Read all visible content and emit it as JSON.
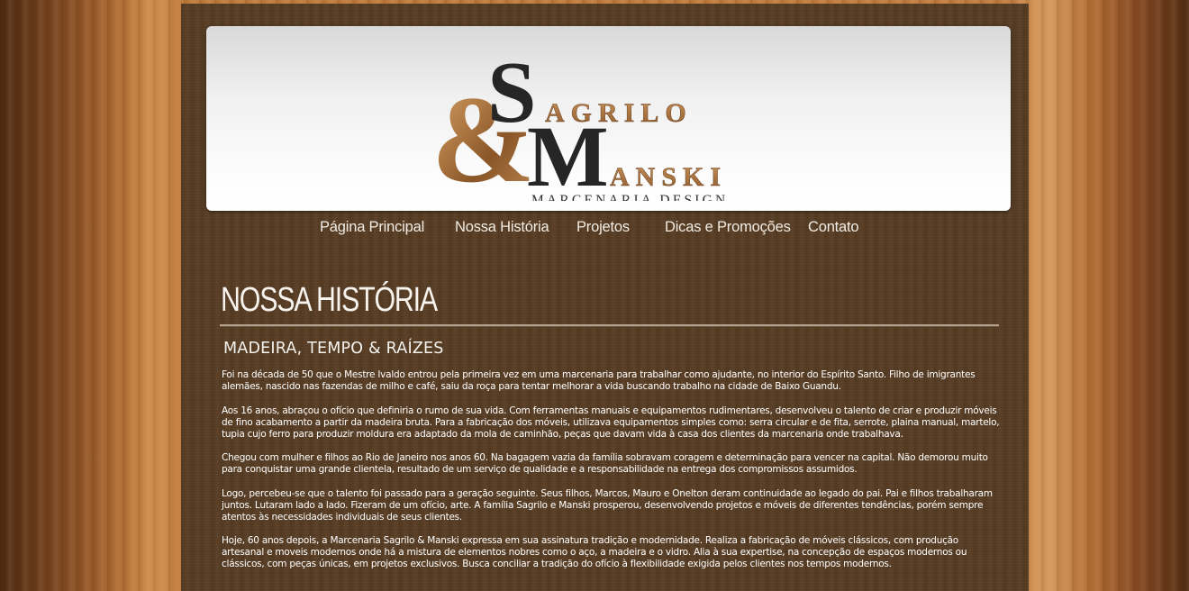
{
  "logo": {
    "big_s": "S",
    "word1": "AGRILO",
    "ampersand": "&",
    "big_m": "M",
    "word2": "ANSKI",
    "tagline": "MARCENARIA DESIGN"
  },
  "nav": {
    "items": [
      {
        "label": "Página Principal"
      },
      {
        "label": "Nossa História"
      },
      {
        "label": "Projetos"
      },
      {
        "label": "Dicas e Promoções"
      },
      {
        "label": "Contato"
      }
    ]
  },
  "page": {
    "title": "NOSSA HISTÓRIA",
    "subtitle": "MADEIRA, TEMPO & RAÍZES",
    "paragraphs": [
      "Foi na década de 50 que o Mestre Ivaldo entrou pela primeira vez em uma marcenaria para trabalhar como ajudante, no interior do Espírito Santo. Filho de imigrantes alemães, nascido nas fazendas de milho e café, saiu da roça para tentar melhorar a vida buscando trabalho na cidade de Baixo Guandu.",
      "Aos 16 anos, abraçou o ofício que definiria o rumo de sua vida. Com ferramentas manuais e equipamentos rudimentares, desenvolveu o talento de criar e produzir móveis de fino acabamento a partir da madeira bruta. Para a fabricação dos móveis, utilizava equipamentos simples como: serra circular e de fita, serrote, plaina manual, martelo, tupia cujo ferro para produzir moldura era adaptado da mola de caminhão, peças que davam vida à casa dos clientes da marcenaria onde trabalhava.",
      "Chegou com mulher e filhos ao Rio de Janeiro nos anos 60. Na bagagem vazia da família sobravam coragem e determinação para vencer na capital. Não demorou muito para conquistar uma grande clientela, resultado de um serviço de qualidade e a responsabilidade na entrega dos compromissos assumidos.",
      "Logo, percebeu-se que o talento foi passado para a geração seguinte. Seus filhos, Marcos, Mauro e Onelton deram continuidade ao legado do pai. Pai e filhos trabalharam juntos. Lutaram lado a lado. Fizeram de um ofício, arte. A família Sagrilo e Manski prosperou, desenvolvendo projetos e móveis de diferentes tendências, porém sempre atentos às necessidades individuais de seus clientes.",
      "Hoje, 60 anos depois, a Marcenaria Sagrilo & Manski expressa em sua assinatura tradição e modernidade. Realiza a fabricação de móveis clássicos, com produção artesanal e moveis modernos onde há a mistura de elementos nobres como o aço, a madeira e o vidro. Alia à sua expertise, na concepção de espaços modernos ou clássicos, com peças únicas, em projetos exclusivos. Busca conciliar a tradição do ofício à flexibilidade exigida pelos clientes nos tempos modernos."
    ]
  },
  "colors": {
    "wood_accent": "#b07a45",
    "logo_dark": "#2a2a2a",
    "panel": "#553b22",
    "text": "#ffffff"
  }
}
